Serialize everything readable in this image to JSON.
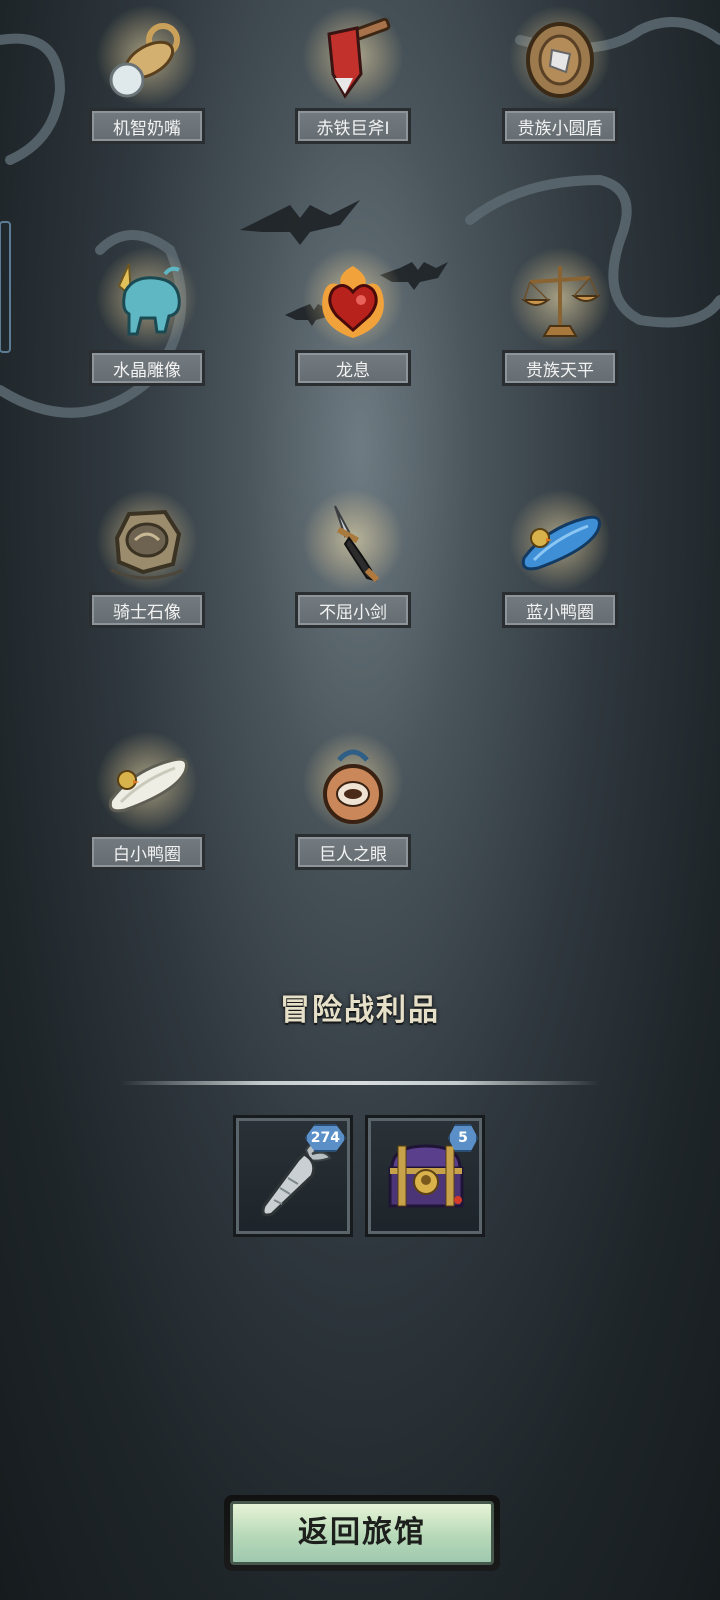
{
  "relics": [
    {
      "name": "机智奶嘴",
      "icon": "pacifier-icon"
    },
    {
      "name": "赤铁巨斧I",
      "icon": "red-axe-icon"
    },
    {
      "name": "贵族小圆盾",
      "icon": "round-shield-icon"
    },
    {
      "name": "水晶雕像",
      "icon": "crystal-rhino-statue-icon"
    },
    {
      "name": "龙息",
      "icon": "flaming-heart-icon"
    },
    {
      "name": "贵族天平",
      "icon": "scales-icon"
    },
    {
      "name": "骑士石像",
      "icon": "stone-ring-icon"
    },
    {
      "name": "不屈小剑",
      "icon": "short-sword-icon"
    },
    {
      "name": "蓝小鸭圈",
      "icon": "blue-duck-float-icon"
    },
    {
      "name": "白小鸭圈",
      "icon": "white-duck-float-icon"
    },
    {
      "name": "巨人之眼",
      "icon": "giant-eye-amulet-icon"
    }
  ],
  "loot": {
    "title": "冒险战利品",
    "items": [
      {
        "icon": "silver-carrot-icon",
        "count": "274"
      },
      {
        "icon": "treasure-chest-icon",
        "count": "5"
      }
    ]
  },
  "return_button": {
    "label": "返回旅馆"
  },
  "colors": {
    "label_bg": "#6b7378",
    "badge": "#5a8fc8",
    "button_face": "#c7e3c2",
    "title_text": "#e7e0c9"
  }
}
